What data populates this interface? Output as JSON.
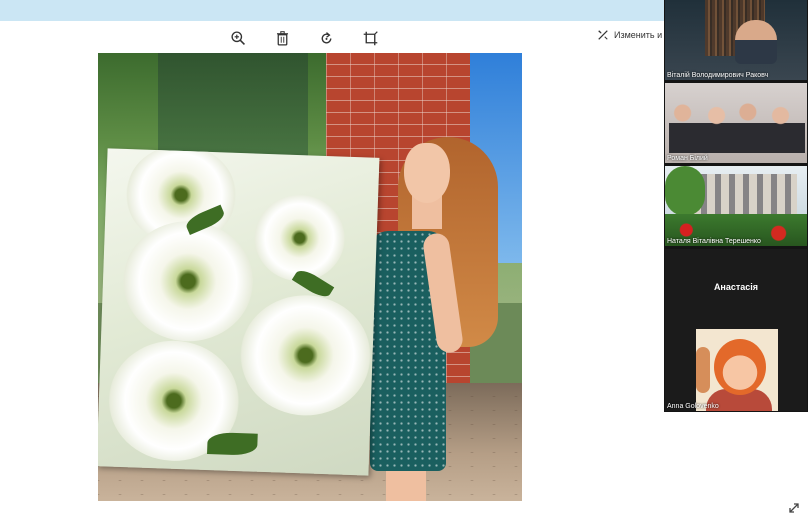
{
  "toolbar": {
    "zoom_icon": "zoom-in-icon",
    "delete_icon": "trash-icon",
    "rotate_icon": "rotate-icon",
    "crop_icon": "crop-icon",
    "edit_label": "Изменить и со",
    "edit_icon": "edit-magic-icon"
  },
  "participants": [
    {
      "name": "Віталій Володимирович Раковч"
    },
    {
      "name": "Роман Білий"
    },
    {
      "name": "Наталя Віталівна Терешенко"
    },
    {
      "name": "Anna Golovenko",
      "display_name": "Анастасія"
    }
  ],
  "colors": {
    "topbar": "#cbe6f4",
    "sidebar": "#141414"
  }
}
